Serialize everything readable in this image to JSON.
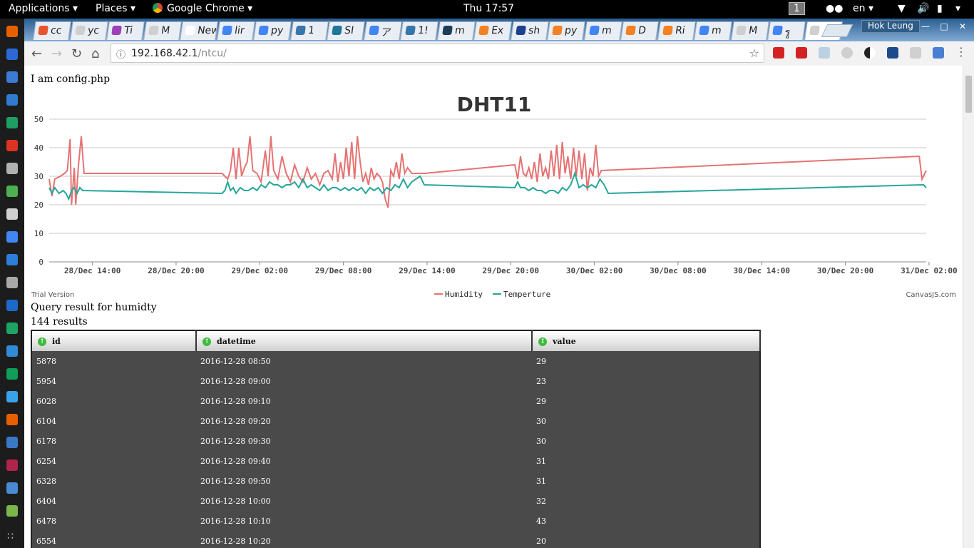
{
  "topbar": {
    "applications": "Applications",
    "places": "Places",
    "app_name": "Google Chrome",
    "clock": "Thu 17:57",
    "workspace": "1",
    "language": "en"
  },
  "browser": {
    "tabs": [
      {
        "label": "cc",
        "icon_color": "#e8542b"
      },
      {
        "label": "yc",
        "icon_color": "#cfcfcf"
      },
      {
        "label": "Ti",
        "icon_color": "#9c3fb8"
      },
      {
        "label": "M",
        "icon_color": "#cfcfcf"
      },
      {
        "label": "New",
        "icon_color": "#ffffff"
      },
      {
        "label": "lir",
        "icon_color": "#4285f4"
      },
      {
        "label": "py",
        "icon_color": "#4285f4"
      },
      {
        "label": "1",
        "icon_color": "#3776ab"
      },
      {
        "label": "SI",
        "icon_color": "#21759b"
      },
      {
        "label": "ア",
        "icon_color": "#4285f4"
      },
      {
        "label": "1!",
        "icon_color": "#3776ab"
      },
      {
        "label": "m",
        "icon_color": "#1c3d5a"
      },
      {
        "label": "Ex",
        "icon_color": "#f48024"
      },
      {
        "label": "sh",
        "icon_color": "#1d3f8f"
      },
      {
        "label": "py",
        "icon_color": "#f48024"
      },
      {
        "label": "m",
        "icon_color": "#4285f4"
      },
      {
        "label": "D",
        "icon_color": "#f48024"
      },
      {
        "label": "Ri",
        "icon_color": "#f48024"
      },
      {
        "label": "m",
        "icon_color": "#4285f4"
      },
      {
        "label": "M",
        "icon_color": "#cfcfcf"
      },
      {
        "label": "รู",
        "icon_color": "#4285f4"
      },
      {
        "label": "",
        "icon_color": "#cfcfcf",
        "active": true
      }
    ],
    "profile": "Hok Leung",
    "url_host": "192.168.42.1",
    "url_path": "/ntcu/"
  },
  "page": {
    "config_text": "I am config.php",
    "trial": "Trial Version",
    "credit": "CanvasJS.com",
    "query_title": "Query result for humidty",
    "result_count": "144 results"
  },
  "chart_data": {
    "type": "line",
    "title": "DHT11",
    "ylim": [
      0,
      50
    ],
    "y_ticks": [
      "0",
      "10",
      "20",
      "30",
      "40",
      "50"
    ],
    "x_tick_labels": [
      "28/Dec 14:00",
      "28/Dec 20:00",
      "29/Dec 02:00",
      "29/Dec 08:00",
      "29/Dec 14:00",
      "29/Dec 20:00",
      "30/Dec 02:00",
      "30/Dec 08:00",
      "30/Dec 14:00",
      "30/Dec 20:00",
      "31/Dec 02:00"
    ],
    "x_ticks_hours_from_28dec_14": [
      0,
      6,
      12,
      18,
      24,
      30,
      36,
      42,
      48,
      54,
      60
    ],
    "x_range_hours": [
      -3.1,
      59.8
    ],
    "grid": true,
    "legend_position": "bottom",
    "series": [
      {
        "name": "Humidity",
        "color": "#e57373",
        "points": [
          [
            -3.1,
            29
          ],
          [
            -2.9,
            23
          ],
          [
            -2.7,
            29
          ],
          [
            -2.3,
            30
          ],
          [
            -2.0,
            31
          ],
          [
            -1.8,
            32
          ],
          [
            -1.6,
            43
          ],
          [
            -1.5,
            20
          ],
          [
            -1.3,
            33
          ],
          [
            -1.2,
            20
          ],
          [
            -1.0,
            34
          ],
          [
            -0.8,
            44
          ],
          [
            -0.6,
            31
          ],
          [
            9.3,
            31
          ],
          [
            9.5,
            30
          ],
          [
            9.7,
            29
          ],
          [
            9.9,
            32
          ],
          [
            10.1,
            40
          ],
          [
            10.3,
            29
          ],
          [
            10.5,
            40
          ],
          [
            10.7,
            30
          ],
          [
            10.9,
            33
          ],
          [
            11.1,
            35
          ],
          [
            11.3,
            44
          ],
          [
            11.5,
            32
          ],
          [
            11.8,
            31
          ],
          [
            12.1,
            28
          ],
          [
            12.4,
            39
          ],
          [
            12.6,
            30
          ],
          [
            12.8,
            44
          ],
          [
            13.0,
            32
          ],
          [
            13.3,
            29
          ],
          [
            13.6,
            37
          ],
          [
            13.9,
            31
          ],
          [
            14.2,
            28
          ],
          [
            14.5,
            34
          ],
          [
            14.8,
            30
          ],
          [
            15.1,
            28
          ],
          [
            15.4,
            33
          ],
          [
            15.7,
            29
          ],
          [
            16.0,
            31
          ],
          [
            16.3,
            27
          ],
          [
            16.6,
            31
          ],
          [
            16.9,
            32
          ],
          [
            17.2,
            29
          ],
          [
            17.4,
            38
          ],
          [
            17.6,
            28
          ],
          [
            17.8,
            35
          ],
          [
            18.0,
            29
          ],
          [
            18.2,
            40
          ],
          [
            18.4,
            30
          ],
          [
            18.6,
            42
          ],
          [
            18.8,
            29
          ],
          [
            19.0,
            44
          ],
          [
            19.2,
            35
          ],
          [
            19.4,
            28
          ],
          [
            19.6,
            31
          ],
          [
            19.8,
            27
          ],
          [
            20.0,
            33
          ],
          [
            20.2,
            29
          ],
          [
            20.4,
            31
          ],
          [
            20.6,
            30
          ],
          [
            20.8,
            28
          ],
          [
            21.0,
            22
          ],
          [
            21.2,
            19
          ],
          [
            21.4,
            32
          ],
          [
            21.6,
            30
          ],
          [
            21.8,
            35
          ],
          [
            22.0,
            29
          ],
          [
            22.2,
            38
          ],
          [
            22.4,
            31
          ],
          [
            22.6,
            33
          ],
          [
            22.9,
            31
          ],
          [
            23.2,
            31
          ],
          [
            23.5,
            31
          ],
          [
            23.8,
            31
          ],
          [
            30.3,
            34
          ],
          [
            30.5,
            29
          ],
          [
            30.7,
            37
          ],
          [
            30.9,
            31
          ],
          [
            31.1,
            30
          ],
          [
            31.3,
            33
          ],
          [
            31.5,
            29
          ],
          [
            31.7,
            35
          ],
          [
            31.9,
            28
          ],
          [
            32.1,
            38
          ],
          [
            32.3,
            30
          ],
          [
            32.5,
            33
          ],
          [
            32.7,
            29
          ],
          [
            32.9,
            39
          ],
          [
            33.1,
            30
          ],
          [
            33.3,
            41
          ],
          [
            33.5,
            29
          ],
          [
            33.7,
            42
          ],
          [
            33.9,
            31
          ],
          [
            34.1,
            37
          ],
          [
            34.3,
            29
          ],
          [
            34.5,
            40
          ],
          [
            34.7,
            30
          ],
          [
            34.9,
            39
          ],
          [
            35.1,
            29
          ],
          [
            35.3,
            38
          ],
          [
            35.5,
            25
          ],
          [
            35.7,
            33
          ],
          [
            35.9,
            30
          ],
          [
            36.1,
            41
          ],
          [
            36.3,
            30
          ],
          [
            36.5,
            32
          ],
          [
            59.3,
            37
          ],
          [
            59.5,
            29
          ],
          [
            59.8,
            32
          ]
        ]
      },
      {
        "name": "Temperture",
        "color": "#26a69a",
        "points": [
          [
            -3.1,
            26
          ],
          [
            -2.9,
            24
          ],
          [
            -2.7,
            26
          ],
          [
            -2.4,
            24
          ],
          [
            -2.1,
            25
          ],
          [
            -1.9,
            24
          ],
          [
            -1.7,
            22
          ],
          [
            -1.5,
            25
          ],
          [
            -1.3,
            26
          ],
          [
            -1.1,
            24
          ],
          [
            -0.9,
            26
          ],
          [
            -0.7,
            25
          ],
          [
            9.3,
            24
          ],
          [
            9.5,
            25
          ],
          [
            9.7,
            28
          ],
          [
            9.9,
            25
          ],
          [
            10.1,
            26
          ],
          [
            10.3,
            24
          ],
          [
            10.6,
            26
          ],
          [
            10.9,
            25
          ],
          [
            11.2,
            25
          ],
          [
            11.5,
            26
          ],
          [
            11.8,
            25
          ],
          [
            12.1,
            27
          ],
          [
            12.4,
            26
          ],
          [
            12.7,
            28
          ],
          [
            13.0,
            27
          ],
          [
            13.3,
            27
          ],
          [
            13.6,
            26
          ],
          [
            13.9,
            27
          ],
          [
            14.2,
            27
          ],
          [
            14.5,
            28
          ],
          [
            14.8,
            26
          ],
          [
            15.1,
            29
          ],
          [
            15.4,
            26
          ],
          [
            15.7,
            27
          ],
          [
            16.0,
            26
          ],
          [
            16.3,
            25
          ],
          [
            16.6,
            27
          ],
          [
            16.9,
            25
          ],
          [
            17.2,
            26
          ],
          [
            17.5,
            26
          ],
          [
            17.8,
            25
          ],
          [
            18.1,
            26
          ],
          [
            18.4,
            25
          ],
          [
            18.7,
            26
          ],
          [
            19.0,
            25
          ],
          [
            19.3,
            26
          ],
          [
            19.6,
            24
          ],
          [
            19.9,
            26
          ],
          [
            20.2,
            25
          ],
          [
            20.5,
            26
          ],
          [
            20.8,
            24
          ],
          [
            21.1,
            26
          ],
          [
            21.4,
            25
          ],
          [
            21.7,
            27
          ],
          [
            22.0,
            26
          ],
          [
            22.3,
            29
          ],
          [
            22.6,
            26
          ],
          [
            22.9,
            28
          ],
          [
            23.2,
            29
          ],
          [
            23.5,
            30
          ],
          [
            23.8,
            27
          ],
          [
            30.3,
            26
          ],
          [
            30.5,
            28
          ],
          [
            30.7,
            26
          ],
          [
            31.0,
            26
          ],
          [
            31.3,
            25
          ],
          [
            31.6,
            26
          ],
          [
            31.9,
            25
          ],
          [
            32.2,
            25
          ],
          [
            32.5,
            24
          ],
          [
            32.8,
            25
          ],
          [
            33.1,
            25
          ],
          [
            33.4,
            24
          ],
          [
            33.7,
            26
          ],
          [
            34.0,
            25
          ],
          [
            34.3,
            27
          ],
          [
            34.6,
            31
          ],
          [
            34.9,
            26
          ],
          [
            35.2,
            27
          ],
          [
            35.5,
            26
          ],
          [
            35.8,
            27
          ],
          [
            36.1,
            26
          ],
          [
            36.4,
            29
          ],
          [
            36.7,
            27
          ],
          [
            37.0,
            24
          ],
          [
            59.6,
            27
          ],
          [
            59.8,
            26
          ]
        ]
      }
    ]
  },
  "table": {
    "headers": [
      "id",
      "datetime",
      "value"
    ],
    "rows": [
      [
        "5878",
        "2016-12-28 08:50",
        "29"
      ],
      [
        "5954",
        "2016-12-28 09:00",
        "23"
      ],
      [
        "6028",
        "2016-12-28 09:10",
        "29"
      ],
      [
        "6104",
        "2016-12-28 09:20",
        "30"
      ],
      [
        "6178",
        "2016-12-28 09:30",
        "30"
      ],
      [
        "6254",
        "2016-12-28 09:40",
        "31"
      ],
      [
        "6328",
        "2016-12-28 09:50",
        "31"
      ],
      [
        "6404",
        "2016-12-28 10:00",
        "32"
      ],
      [
        "6478",
        "2016-12-28 10:10",
        "43"
      ],
      [
        "6554",
        "2016-12-28 10:20",
        "20"
      ]
    ]
  },
  "dock": {
    "colors": [
      "#e66000",
      "#2b6ad6",
      "#3b7bd3",
      "#2e7bcf",
      "#1f9e63",
      "#dd3322",
      "#b0b0b0",
      "#4caf50",
      "#d0d0d0",
      "#4285f4",
      "#2d7ed9",
      "#a8a8a8",
      "#1b6ac9",
      "#1da462",
      "#2f8ad8",
      "#0f9d58",
      "#3aa0e8",
      "#e66000",
      "#3a78c7",
      "#b0244c",
      "#4a8ad4",
      "#7ab64a"
    ]
  }
}
